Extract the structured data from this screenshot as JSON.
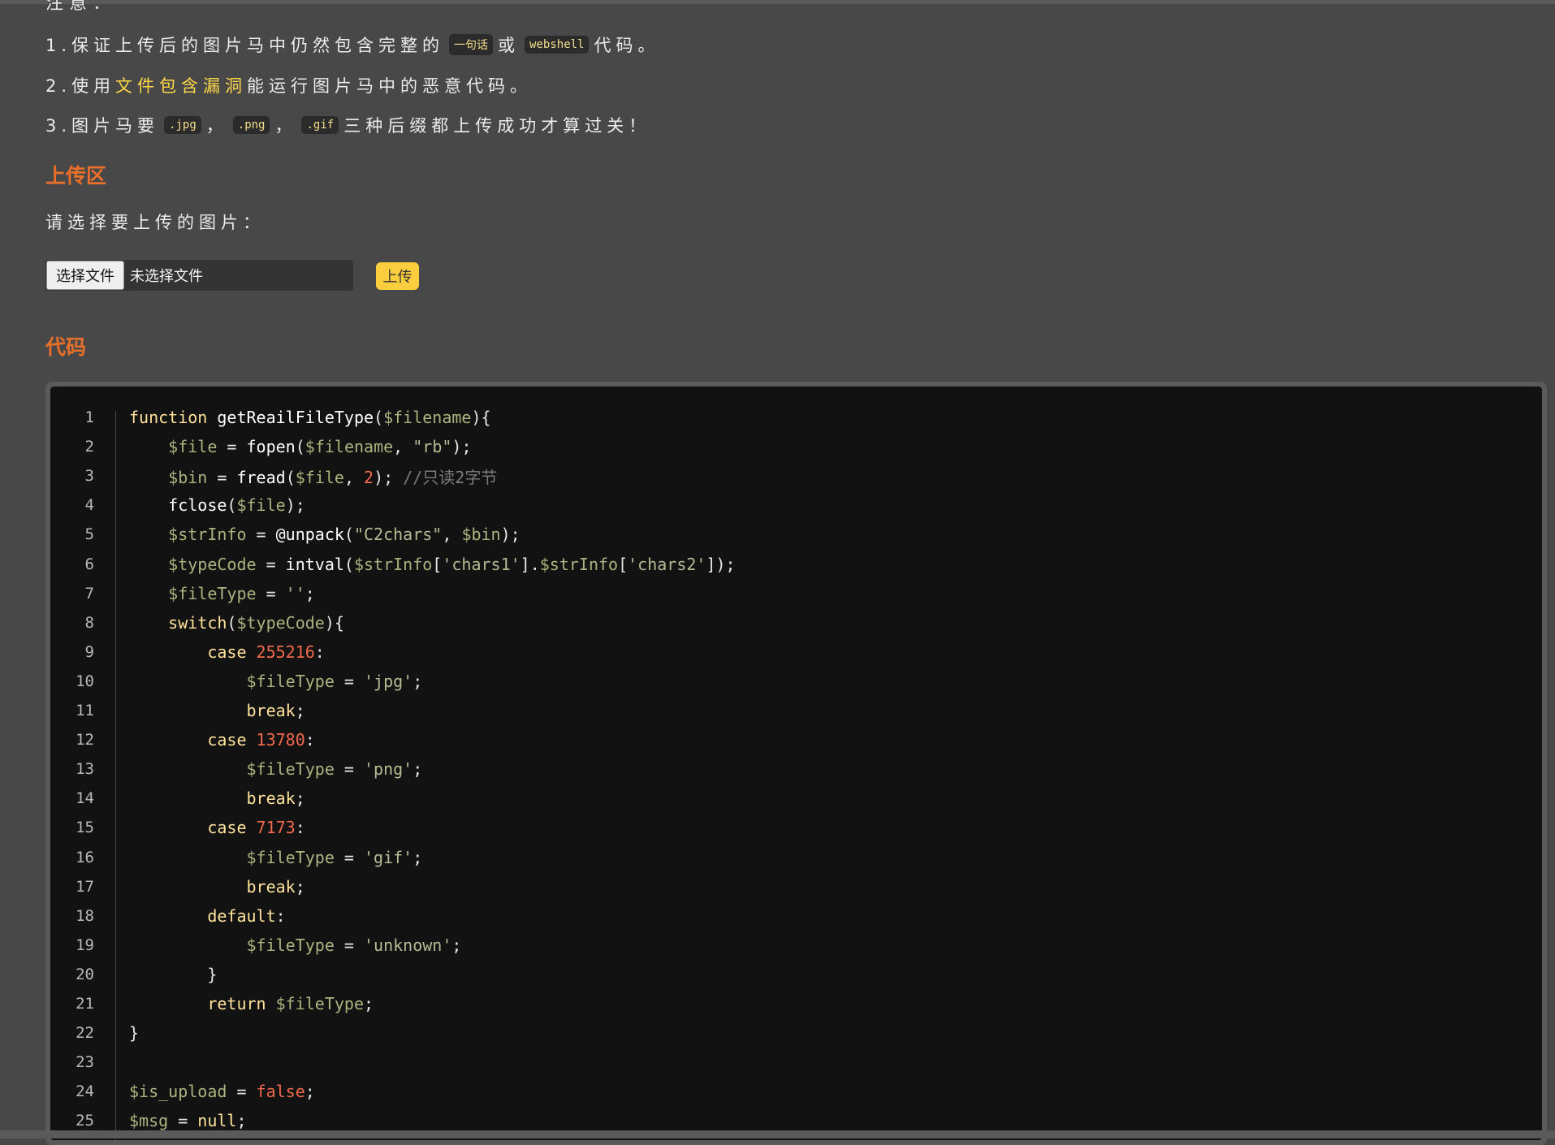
{
  "notes": {
    "cut_label": "注意：",
    "line1": {
      "prefix": "1.保证上传后的图片马中仍然包含完整的",
      "code1": "一句话",
      "mid": "或",
      "code2": "webshell",
      "suffix": "代码。"
    },
    "line2": {
      "prefix": "2.使用",
      "highlight": "文件包含漏洞",
      "suffix": "能运行图片马中的恶意代码。"
    },
    "line3": {
      "prefix": "3.图片马要",
      "ext1": ".jpg",
      "sep1": "，",
      "ext2": ".png",
      "sep2": "，",
      "ext3": ".gif",
      "suffix": "三种后缀都上传成功才算过关！"
    }
  },
  "upload": {
    "title": "上传区",
    "prompt": "请选择要上传的图片：",
    "choose_button": "选择文件",
    "file_status": "未选择文件",
    "submit_button": "上传"
  },
  "code_section": {
    "title": "代码",
    "lines": [
      {
        "n": "1",
        "t": [
          [
            "k",
            "function "
          ],
          [
            "f",
            "getReailFileType"
          ],
          [
            "p",
            "("
          ],
          [
            "v",
            "$filename"
          ],
          [
            "p",
            "){"
          ]
        ]
      },
      {
        "n": "2",
        "t": [
          [
            "p",
            "    "
          ],
          [
            "v",
            "$file"
          ],
          [
            "p",
            " = "
          ],
          [
            "f",
            "fopen"
          ],
          [
            "p",
            "("
          ],
          [
            "v",
            "$filename"
          ],
          [
            "p",
            ", "
          ],
          [
            "s",
            "\"rb\""
          ],
          [
            "p",
            ");"
          ]
        ]
      },
      {
        "n": "3",
        "t": [
          [
            "p",
            "    "
          ],
          [
            "v",
            "$bin"
          ],
          [
            "p",
            " = "
          ],
          [
            "f",
            "fread"
          ],
          [
            "p",
            "("
          ],
          [
            "v",
            "$file"
          ],
          [
            "p",
            ", "
          ],
          [
            "n",
            "2"
          ],
          [
            "p",
            "); "
          ],
          [
            "c",
            "//只读2字节"
          ]
        ]
      },
      {
        "n": "4",
        "t": [
          [
            "p",
            "    "
          ],
          [
            "f",
            "fclose"
          ],
          [
            "p",
            "("
          ],
          [
            "v",
            "$file"
          ],
          [
            "p",
            ");"
          ]
        ]
      },
      {
        "n": "5",
        "t": [
          [
            "p",
            "    "
          ],
          [
            "v",
            "$strInfo"
          ],
          [
            "p",
            " = "
          ],
          [
            "f",
            "@unpack"
          ],
          [
            "p",
            "("
          ],
          [
            "s",
            "\"C2chars\""
          ],
          [
            "p",
            ", "
          ],
          [
            "v",
            "$bin"
          ],
          [
            "p",
            ");"
          ]
        ]
      },
      {
        "n": "6",
        "t": [
          [
            "p",
            "    "
          ],
          [
            "v",
            "$typeCode"
          ],
          [
            "p",
            " = "
          ],
          [
            "f",
            "intval"
          ],
          [
            "p",
            "("
          ],
          [
            "v",
            "$strInfo"
          ],
          [
            "p",
            "["
          ],
          [
            "s",
            "'chars1'"
          ],
          [
            "p",
            "]."
          ],
          [
            "v",
            "$strInfo"
          ],
          [
            "p",
            "["
          ],
          [
            "s",
            "'chars2'"
          ],
          [
            "p",
            "]);"
          ]
        ]
      },
      {
        "n": "7",
        "t": [
          [
            "p",
            "    "
          ],
          [
            "v",
            "$fileType"
          ],
          [
            "p",
            " = "
          ],
          [
            "s",
            "''"
          ],
          [
            "p",
            ";"
          ]
        ]
      },
      {
        "n": "8",
        "t": [
          [
            "p",
            "    "
          ],
          [
            "k",
            "switch"
          ],
          [
            "p",
            "("
          ],
          [
            "v",
            "$typeCode"
          ],
          [
            "p",
            "){"
          ]
        ]
      },
      {
        "n": "9",
        "t": [
          [
            "p",
            "        "
          ],
          [
            "k",
            "case "
          ],
          [
            "n",
            "255216"
          ],
          [
            "p",
            ":"
          ]
        ]
      },
      {
        "n": "10",
        "t": [
          [
            "p",
            "            "
          ],
          [
            "v",
            "$fileType"
          ],
          [
            "p",
            " = "
          ],
          [
            "s",
            "'jpg'"
          ],
          [
            "p",
            ";"
          ]
        ]
      },
      {
        "n": "11",
        "t": [
          [
            "p",
            "            "
          ],
          [
            "k",
            "break"
          ],
          [
            "p",
            ";"
          ]
        ]
      },
      {
        "n": "12",
        "t": [
          [
            "p",
            "        "
          ],
          [
            "k",
            "case "
          ],
          [
            "n",
            "13780"
          ],
          [
            "p",
            ":"
          ]
        ]
      },
      {
        "n": "13",
        "t": [
          [
            "p",
            "            "
          ],
          [
            "v",
            "$fileType"
          ],
          [
            "p",
            " = "
          ],
          [
            "s",
            "'png'"
          ],
          [
            "p",
            ";"
          ]
        ]
      },
      {
        "n": "14",
        "t": [
          [
            "p",
            "            "
          ],
          [
            "k",
            "break"
          ],
          [
            "p",
            ";"
          ]
        ]
      },
      {
        "n": "15",
        "t": [
          [
            "p",
            "        "
          ],
          [
            "k",
            "case "
          ],
          [
            "n",
            "7173"
          ],
          [
            "p",
            ":"
          ]
        ]
      },
      {
        "n": "16",
        "t": [
          [
            "p",
            "            "
          ],
          [
            "v",
            "$fileType"
          ],
          [
            "p",
            " = "
          ],
          [
            "s",
            "'gif'"
          ],
          [
            "p",
            ";"
          ]
        ]
      },
      {
        "n": "17",
        "t": [
          [
            "p",
            "            "
          ],
          [
            "k",
            "break"
          ],
          [
            "p",
            ";"
          ]
        ]
      },
      {
        "n": "18",
        "t": [
          [
            "p",
            "        "
          ],
          [
            "k",
            "default"
          ],
          [
            "p",
            ":"
          ]
        ]
      },
      {
        "n": "19",
        "t": [
          [
            "p",
            "            "
          ],
          [
            "v",
            "$fileType"
          ],
          [
            "p",
            " = "
          ],
          [
            "s",
            "'unknown'"
          ],
          [
            "p",
            ";"
          ]
        ]
      },
      {
        "n": "20",
        "t": [
          [
            "p",
            "        }"
          ]
        ]
      },
      {
        "n": "21",
        "t": [
          [
            "p",
            "        "
          ],
          [
            "k",
            "return "
          ],
          [
            "v",
            "$fileType"
          ],
          [
            "p",
            ";"
          ]
        ]
      },
      {
        "n": "22",
        "t": [
          [
            "p",
            "}"
          ]
        ]
      },
      {
        "n": "23",
        "t": []
      },
      {
        "n": "24",
        "t": [
          [
            "v",
            "$is_upload"
          ],
          [
            "p",
            " = "
          ],
          [
            "n",
            "false"
          ],
          [
            "p",
            ";"
          ]
        ]
      },
      {
        "n": "25",
        "t": [
          [
            "v",
            "$msg"
          ],
          [
            "p",
            " = "
          ],
          [
            "k",
            "null"
          ],
          [
            "p",
            ";"
          ]
        ]
      }
    ]
  }
}
